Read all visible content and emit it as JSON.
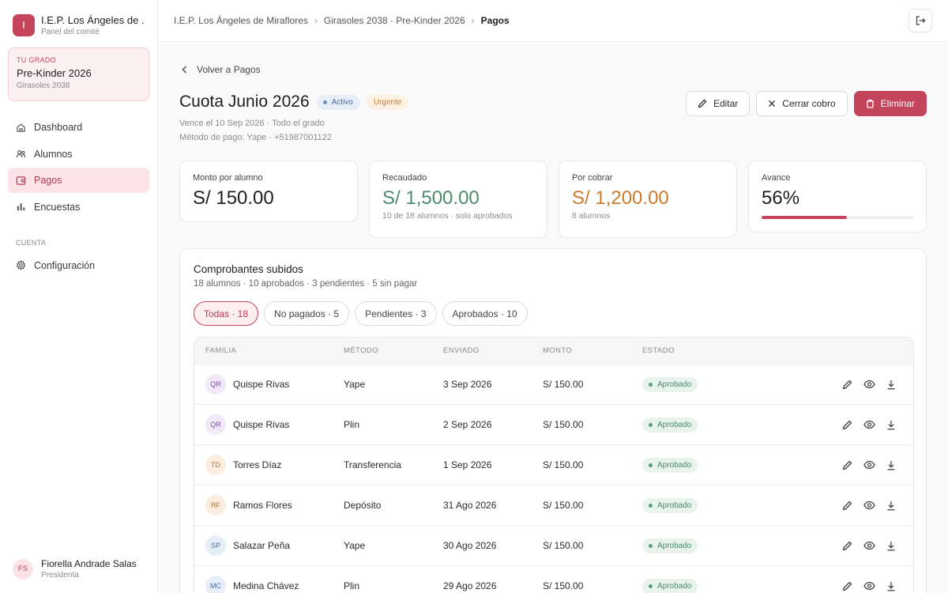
{
  "org": {
    "initial": "I",
    "name": "I.E.P. Los Ángeles de ...",
    "subtitle": "Panel del comité"
  },
  "grade": {
    "tag": "TU GRADO",
    "name": "Pre-Kinder 2026",
    "sub": "Girasoles 2038"
  },
  "nav": [
    {
      "label": "Dashboard",
      "icon": "home-icon"
    },
    {
      "label": "Alumnos",
      "icon": "users-icon"
    },
    {
      "label": "Pagos",
      "icon": "wallet-icon",
      "active": true
    },
    {
      "label": "Encuestas",
      "icon": "bar-chart-icon"
    }
  ],
  "section_account": "CUENTA",
  "settings_label": "Configuración",
  "user": {
    "initials": "FS",
    "name": "Fiorella Andrade Salas",
    "role": "Presidenta"
  },
  "breadcrumb": [
    "I.E.P. Los Ángeles de Miraflores",
    "Girasoles 2038 · Pre-Kinder 2026",
    "Pagos"
  ],
  "back_label": "Volver a Pagos",
  "page": {
    "title": "Cuota Junio 2026",
    "badge_active": "Activo",
    "badge_urgent": "Urgente",
    "meta1": "Vence el 10 Sep 2026 · Todo el grado",
    "meta2": "Método de pago: Yape · +51987001122"
  },
  "actions": {
    "edit": "Editar",
    "close": "Cerrar cobro",
    "delete": "Eliminar"
  },
  "stats": {
    "amount": {
      "label": "Monto por alumno",
      "value": "S/ 150.00"
    },
    "collected": {
      "label": "Recaudado",
      "value": "S/ 1,500.00",
      "sub": "10 de 18 alumnos · solo aprobados"
    },
    "pending": {
      "label": "Por cobrar",
      "value": "S/ 1,200.00",
      "sub": "8 alumnos"
    },
    "progress": {
      "label": "Avance",
      "value": "56%",
      "fraction": 0.56
    }
  },
  "panel": {
    "title": "Comprobantes subidos",
    "subtitle": "18 alumnos · 10 aprobados · 3 pendientes · 5 sin pagar",
    "filters": [
      "Todas · 18",
      "No pagados · 5",
      "Pendientes · 3",
      "Aprobados · 10"
    ]
  },
  "table": {
    "headers": [
      "FAMILIA",
      "MÉTODO",
      "ENVIADO",
      "MONTO",
      "ESTADO"
    ],
    "rows": [
      {
        "initials": "QR",
        "name": "Quispe Rivas",
        "method": "Yape",
        "sent": "3 Sep 2026",
        "amount": "S/ 150.00",
        "status": "Aprobado",
        "bg": "#f1e8f8",
        "fg": "#7a55a0"
      },
      {
        "initials": "QR",
        "name": "Quispe Rivas",
        "method": "Plin",
        "sent": "2 Sep 2026",
        "amount": "S/ 150.00",
        "status": "Aprobado",
        "bg": "#f1e8f8",
        "fg": "#7a55a0"
      },
      {
        "initials": "TD",
        "name": "Torres Díaz",
        "method": "Transferencia",
        "sent": "1 Sep 2026",
        "amount": "S/ 150.00",
        "status": "Aprobado",
        "bg": "#fbeee0",
        "fg": "#b0743a"
      },
      {
        "initials": "RF",
        "name": "Ramos Flores",
        "method": "Depósito",
        "sent": "31 Ago 2026",
        "amount": "S/ 150.00",
        "status": "Aprobado",
        "bg": "#fbeee0",
        "fg": "#b0743a"
      },
      {
        "initials": "SP",
        "name": "Salazar Peña",
        "method": "Yape",
        "sent": "30 Ago 2026",
        "amount": "S/ 150.00",
        "status": "Aprobado",
        "bg": "#e6eef8",
        "fg": "#4e6f9e"
      },
      {
        "initials": "MC",
        "name": "Medina Chávez",
        "method": "Plin",
        "sent": "29 Ago 2026",
        "amount": "S/ 150.00",
        "status": "Aprobado",
        "bg": "#e6eef8",
        "fg": "#4e6f9e"
      }
    ]
  }
}
